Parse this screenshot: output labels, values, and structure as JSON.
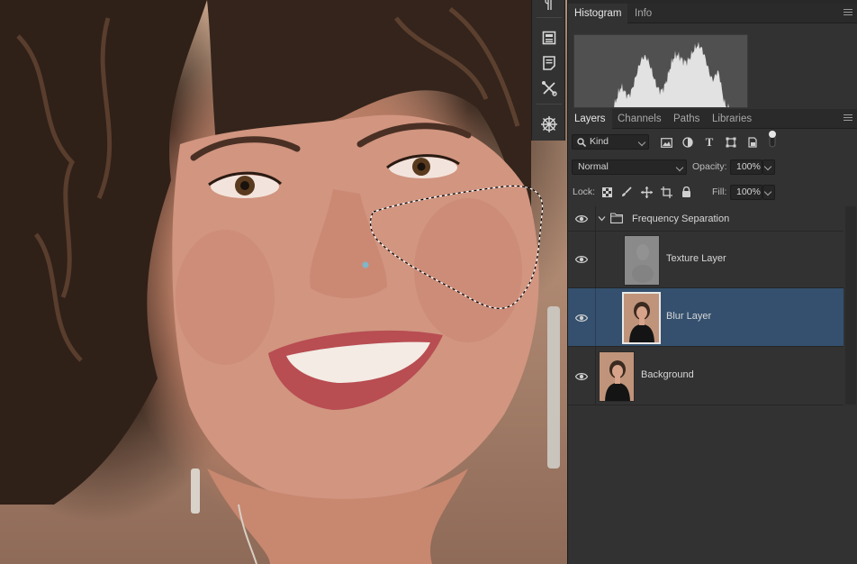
{
  "histogram_panel": {
    "tabs": [
      {
        "label": "Histogram",
        "active": true
      },
      {
        "label": "Info",
        "active": false
      }
    ]
  },
  "layers_panel": {
    "tabs": [
      {
        "label": "Layers",
        "active": true
      },
      {
        "label": "Channels",
        "active": false
      },
      {
        "label": "Paths",
        "active": false
      },
      {
        "label": "Libraries",
        "active": false
      }
    ],
    "filter_kind": "Kind",
    "filter_icons": [
      "image-filter-icon",
      "adjustment-filter-icon",
      "type-filter-icon",
      "shape-filter-icon",
      "smart-object-filter-icon",
      "filter-toggle-icon"
    ],
    "blend_mode": "Normal",
    "opacity_label": "Opacity:",
    "opacity_value": "100%",
    "lock_label": "Lock:",
    "lock_icons": [
      "lock-transparent-icon",
      "lock-image-icon",
      "lock-position-icon",
      "lock-artboard-icon",
      "lock-all-icon"
    ],
    "fill_label": "Fill:",
    "fill_value": "100%",
    "layers": [
      {
        "name": "Frequency Separation",
        "type": "group",
        "visible": true,
        "expanded": true,
        "selected": false
      },
      {
        "name": "Texture Layer",
        "type": "layer",
        "visible": true,
        "selected": false,
        "indent": true
      },
      {
        "name": "Blur Layer",
        "type": "layer",
        "visible": true,
        "selected": true,
        "indent": true
      },
      {
        "name": "Background",
        "type": "layer",
        "visible": true,
        "selected": false,
        "indent": false
      }
    ]
  },
  "tool_strip": {
    "icons": [
      "paragraph-icon",
      "properties-icon",
      "notes-icon",
      "tools-preset-icon",
      "brush-settings-icon"
    ]
  },
  "colors": {
    "panel_bg": "#323232",
    "selected_row": "#34506e",
    "histogram_fill": "#e2e2e2"
  }
}
